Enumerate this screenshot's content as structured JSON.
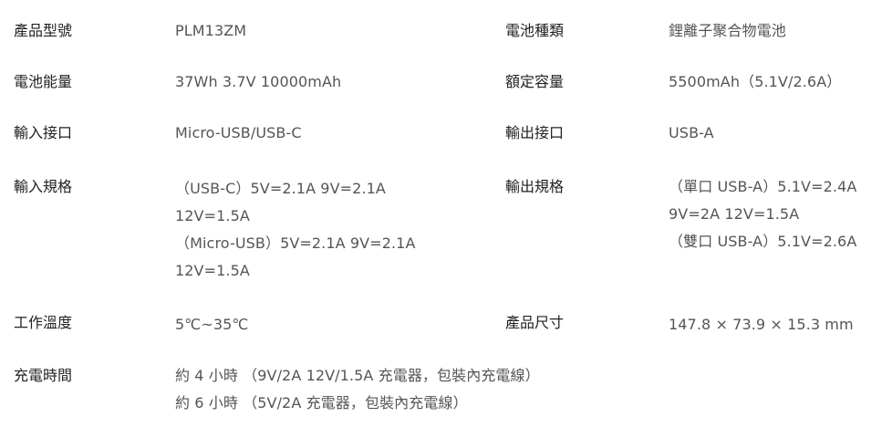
{
  "specs": {
    "model": {
      "label": "產品型號",
      "value": "PLM13ZM"
    },
    "battery_type": {
      "label": "電池種類",
      "value": "鋰離子聚合物電池"
    },
    "energy": {
      "label": "電池能量",
      "value": "37Wh 3.7V 10000mAh"
    },
    "rated_capacity": {
      "label": "額定容量",
      "value": "5500mAh（5.1V/2.6A）"
    },
    "input_port": {
      "label": "輸入接口",
      "value": "Micro-USB/USB-C"
    },
    "output_port": {
      "label": "輸出接口",
      "value": "USB-A"
    },
    "input_spec": {
      "label": "輸入規格",
      "lines": [
        "（USB-C）5V=2.1A  9V=2.1A",
        "12V=1.5A",
        "（Micro-USB）5V=2.1A  9V=2.1A",
        "12V=1.5A"
      ]
    },
    "output_spec": {
      "label": "輸出規格",
      "lines": [
        "（單口 USB-A）5.1V=2.4A",
        "9V=2A  12V=1.5A",
        "（雙口 USB-A）5.1V=2.6A"
      ]
    },
    "temperature": {
      "label": "工作溫度",
      "value": "5℃~35℃"
    },
    "dimensions": {
      "label": "產品尺寸",
      "value": "147.8 × 73.9 × 15.3 mm"
    },
    "charge_time": {
      "label": "充電時間",
      "lines": [
        "約 4 小時 （9V/2A 12V/1.5A 充電器，包裝內充電線）",
        "約 6 小時 （5V/2A 充電器，包裝內充電線）"
      ]
    }
  }
}
